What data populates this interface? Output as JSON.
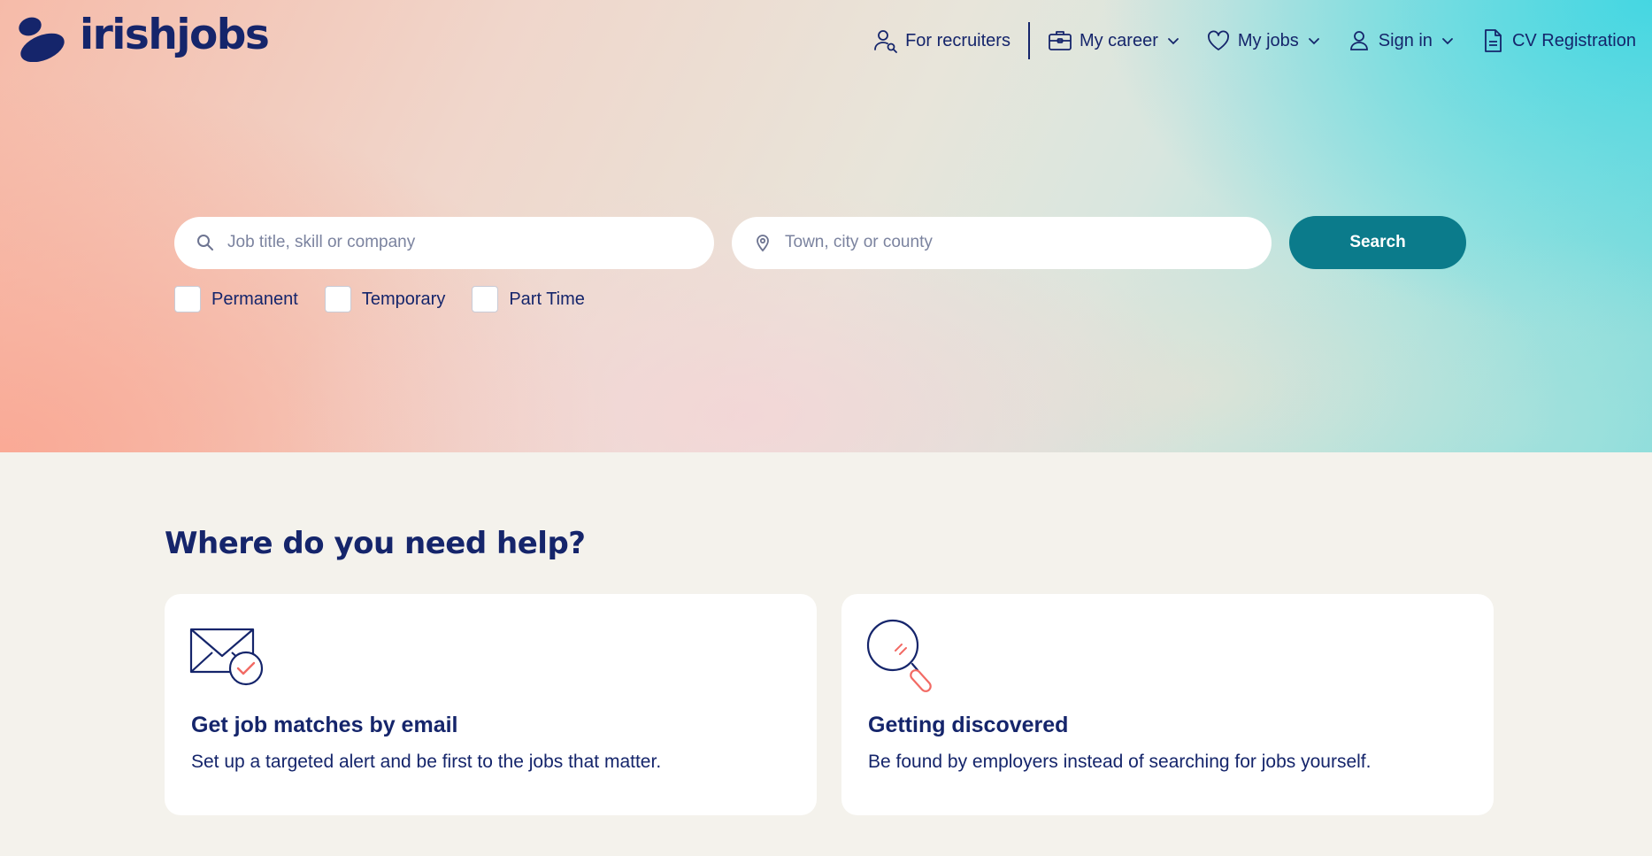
{
  "header": {
    "logo_text": "irishjobs",
    "nav": [
      {
        "label": "For recruiters",
        "icon": "person-search-icon"
      },
      {
        "label": "My career",
        "icon": "briefcase-icon"
      },
      {
        "label": "My jobs",
        "icon": "heart-icon"
      },
      {
        "label": "Sign in",
        "icon": "user-icon"
      },
      {
        "label": "CV Registration",
        "icon": "document-icon"
      }
    ]
  },
  "search": {
    "keyword_placeholder": "Job title, skill or company",
    "location_placeholder": "Town, city or county",
    "button_label": "Search",
    "filters": [
      {
        "label": "Permanent",
        "checked": false
      },
      {
        "label": "Temporary",
        "checked": false
      },
      {
        "label": "Part Time",
        "checked": false
      }
    ]
  },
  "help": {
    "title": "Where do you need help?",
    "cards": [
      {
        "title": "Get job matches by email",
        "text": "Set up a targeted alert and be first to the jobs that matter.",
        "icon": "envelope-check-icon"
      },
      {
        "title": "Getting discovered",
        "text": "Be found by employers instead of searching for jobs yourself.",
        "icon": "magnifier-icon"
      }
    ]
  },
  "colors": {
    "brand_navy": "#15256b",
    "search_button": "#0b7b8b",
    "accent_coral": "#f26a64",
    "page_background": "#f4f2ec"
  }
}
